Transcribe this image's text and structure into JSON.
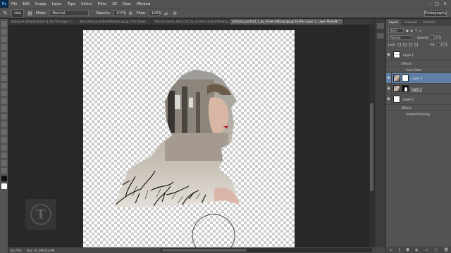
{
  "app": {
    "logo_text": "Ps"
  },
  "menu": [
    "File",
    "Edit",
    "Image",
    "Layer",
    "Type",
    "Select",
    "Filter",
    "3D",
    "View",
    "Window"
  ],
  "options": {
    "brush_size": "2000",
    "mode_label": "Mode:",
    "mode_value": "Normal",
    "opacity_label": "Opacity:",
    "opacity_value": "100%",
    "flow_label": "Flow:",
    "flow_value": "100%",
    "workspace": "Photography"
  },
  "tabs": [
    "exposure advanced.psd @ 16.7% (Layer 1...",
    "Branches_by_liefmedfensels.jpg @ 25% (Layer...",
    "french_course_stock_16_by_mulsini_stock-d7bhbca.jpg @...",
    "princess_portrait_1_by_kinker-d4bnqt.jpg @ 16.8% (Layer 3, Layer Mask/8) *"
  ],
  "status": {
    "zoom": "16.79%",
    "doc": "Doc: 61.3M/353.6M"
  },
  "panel": {
    "tabs": [
      "Layers",
      "Channels",
      "Contents"
    ],
    "kind_label": "Kind",
    "blend_mode": "Normal",
    "opacity_label": "Opacity:",
    "opacity_value": "100%",
    "lock_label": "Lock:",
    "fill_label": "Fill:",
    "fill_value": "100%"
  },
  "layers": [
    {
      "name": "Layer 1",
      "thumb": "checker",
      "effects": [
        "Effects",
        "Inner Glow"
      ],
      "selected": false
    },
    {
      "name": "Layer 3",
      "thumb": "photo",
      "mask": true,
      "selected": true
    },
    {
      "name": "Layer 0",
      "thumb": "photo",
      "mask": true,
      "selected": false,
      "underline": true
    },
    {
      "name": "Layer 2",
      "thumb": "white",
      "effects": [
        "Effects",
        "Gradient Overlay"
      ],
      "selected": false
    }
  ]
}
